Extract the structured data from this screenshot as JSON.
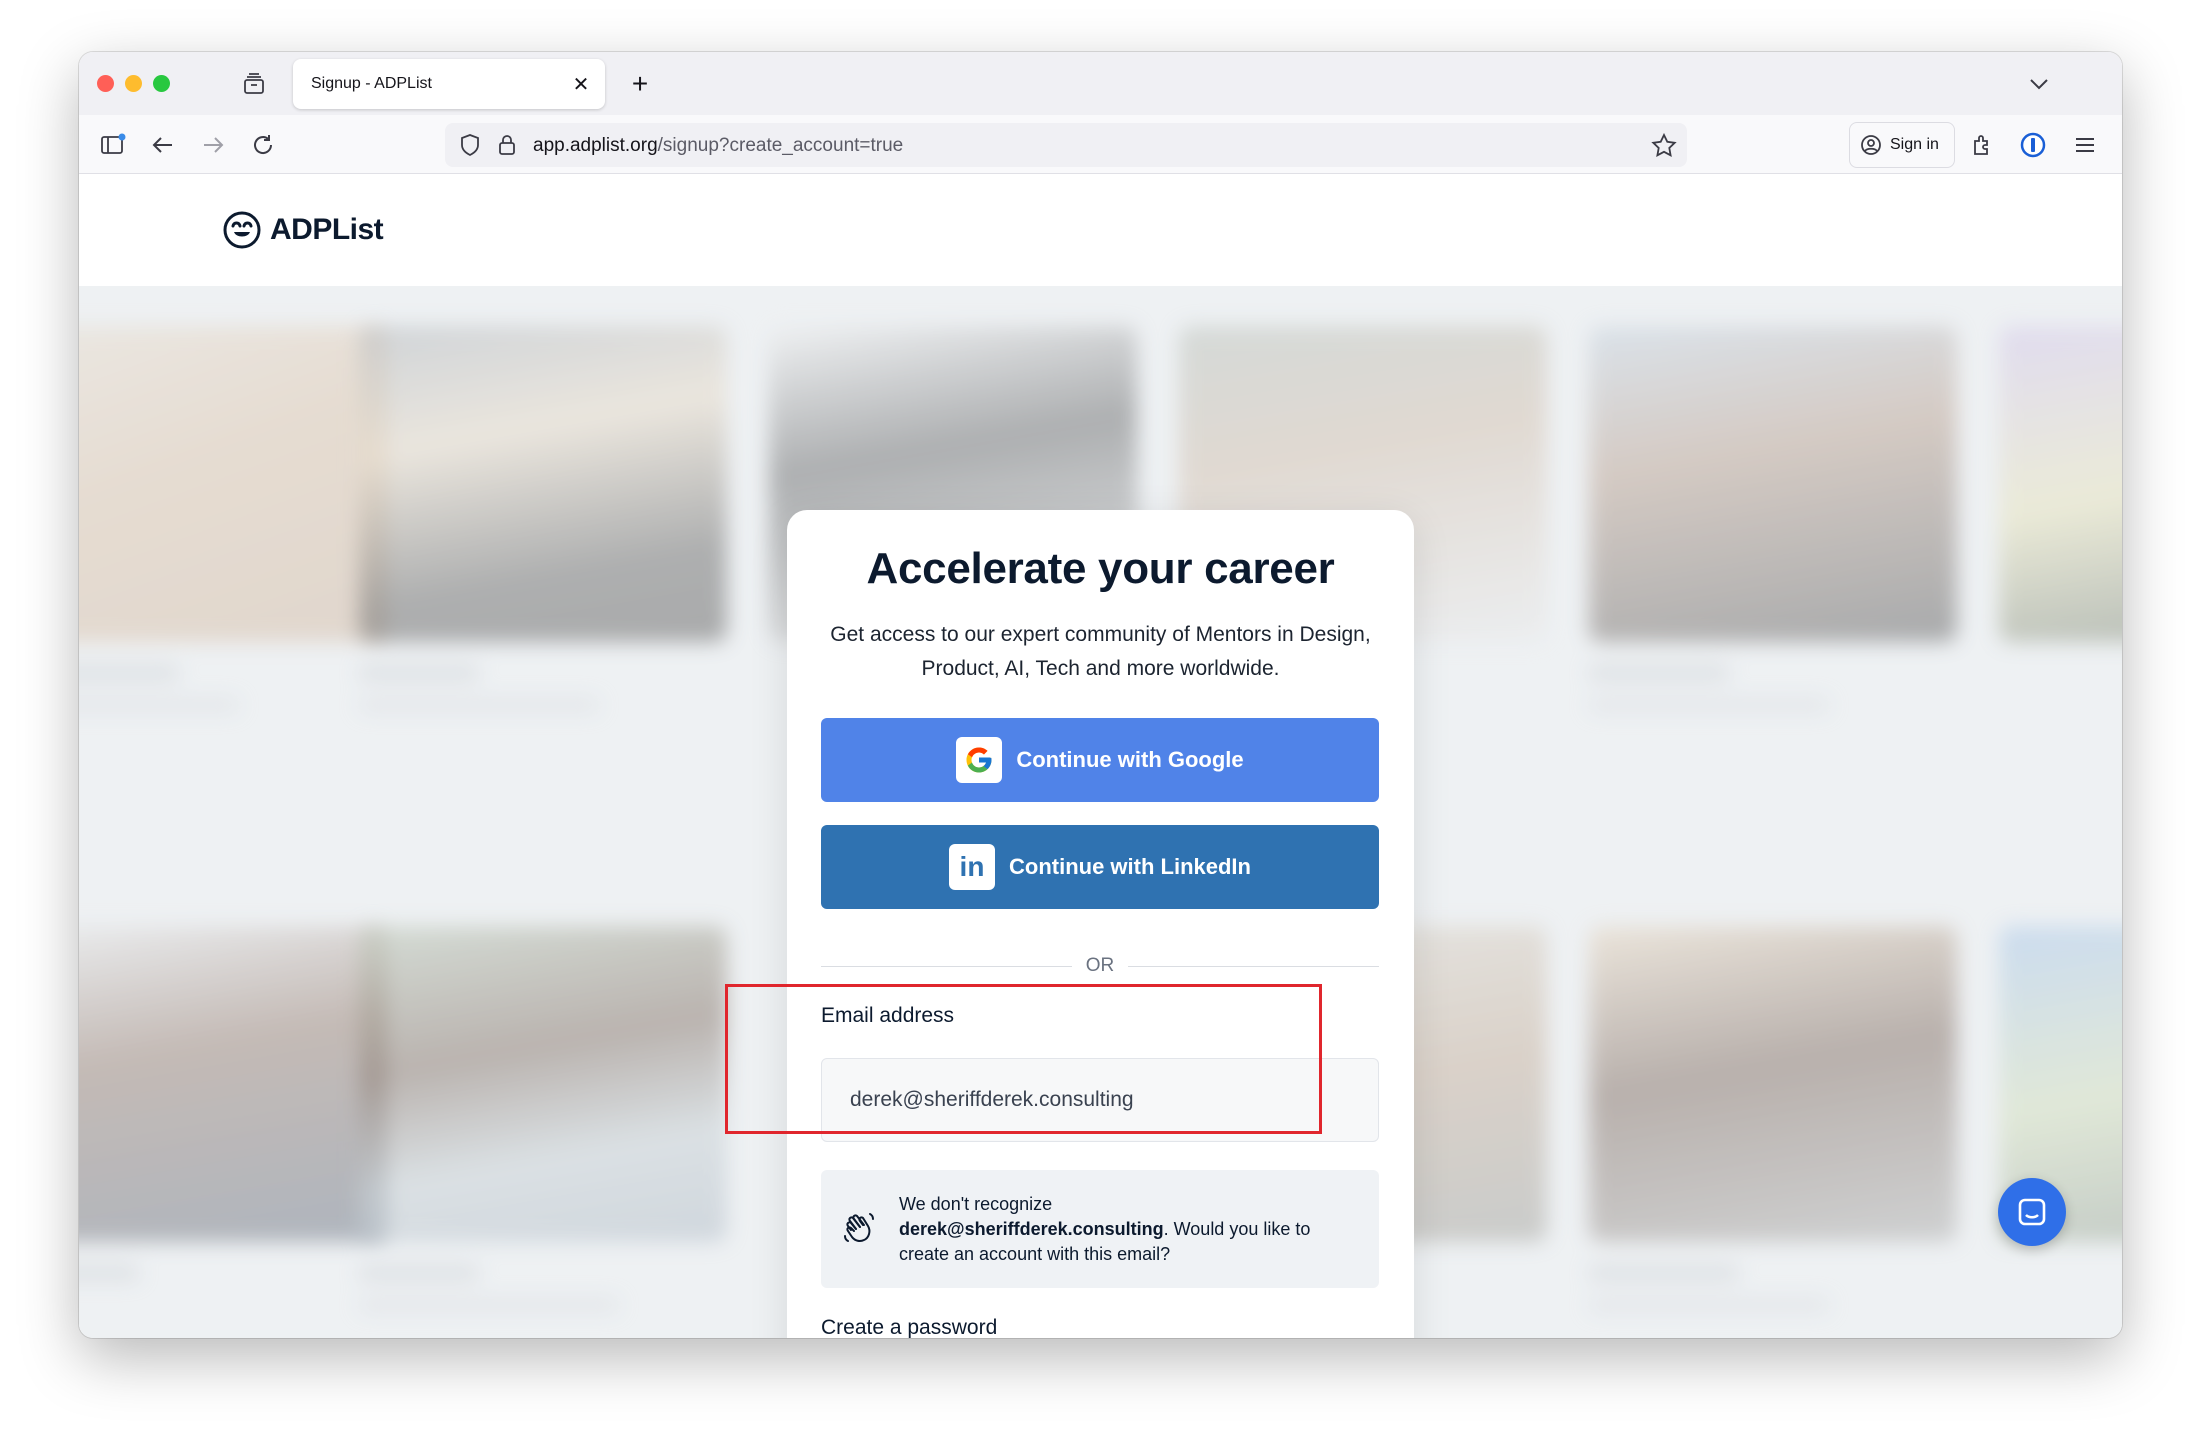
{
  "browser": {
    "tab_title": "Signup - ADPList",
    "tab_close": "✕",
    "new_tab": "+",
    "url_host": "app.adplist.org",
    "url_path": "/signup?create_account=true",
    "sign_in_label": "Sign in"
  },
  "site": {
    "logo_text": "ADPList"
  },
  "signup": {
    "title": "Accelerate your career",
    "subtitle": "Get access to our expert community of Mentors in Design, Product, AI, Tech and more worldwide.",
    "google_label": "Continue with Google",
    "linkedin_label": "Continue with LinkedIn",
    "linkedin_icon_text": "in",
    "divider_text": "OR",
    "email_label": "Email address",
    "email_value": "derek@sheriffderek.consulting",
    "notice_prefix": "We don't recognize",
    "notice_email": "derek@sheriffderek.consulting",
    "notice_suffix": ". Would you like to create an account with this email?",
    "password_label": "Create a password"
  },
  "colors": {
    "google_button": "#5083e8",
    "linkedin_button": "#2f72b1",
    "highlight": "#e0262d",
    "chat_button": "#2f6fe8"
  }
}
